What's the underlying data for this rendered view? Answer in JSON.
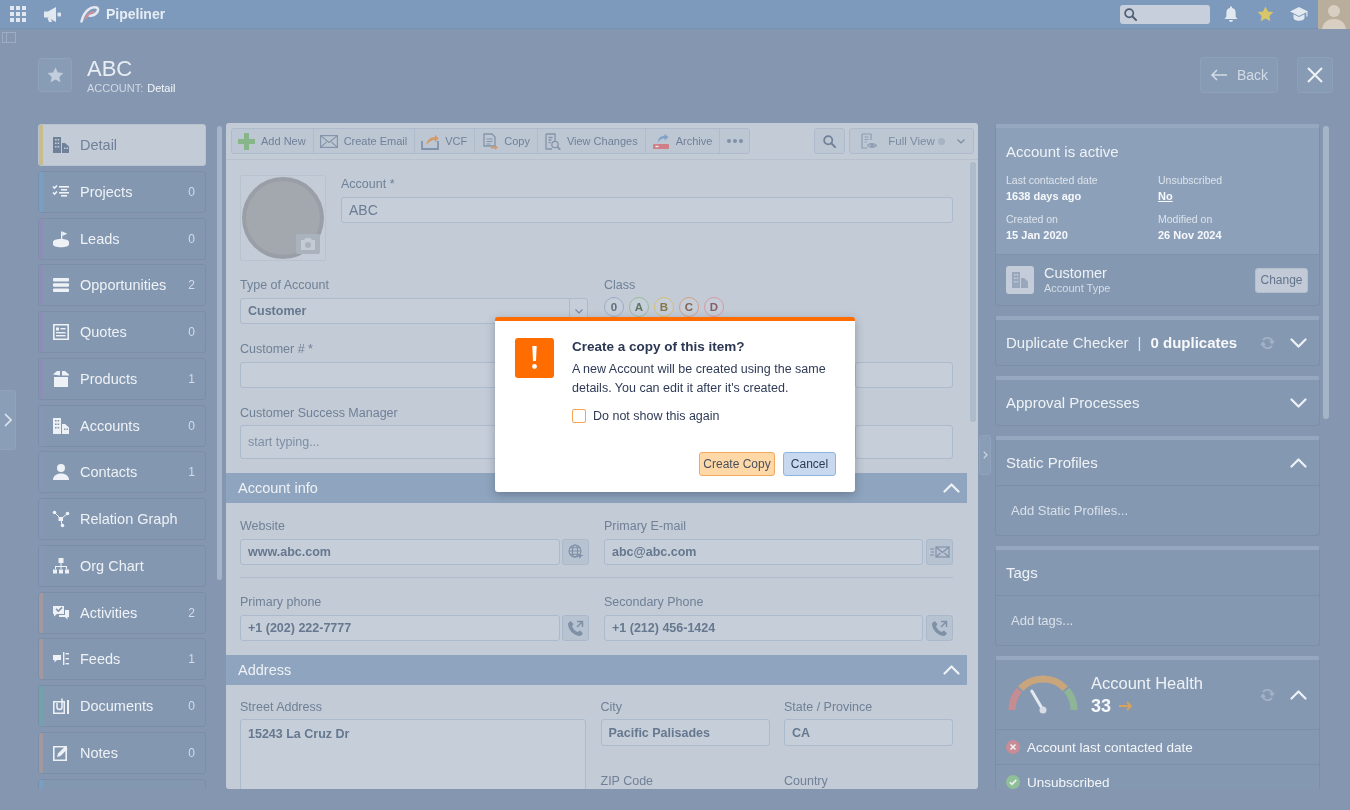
{
  "top_bar": {
    "logo": "Pipeliner"
  },
  "header": {
    "title": "ABC",
    "record_type": "ACCOUNT:",
    "view": "Detail",
    "back": "Back"
  },
  "sidebar": {
    "items": [
      {
        "label": "Detail",
        "selected": true,
        "color": "#c8bc8c"
      },
      {
        "label": "Projects",
        "count": "0",
        "selected": false,
        "color": "#7b9fc3"
      },
      {
        "label": "Leads",
        "count": "0",
        "selected": false,
        "color": "#8e8db5"
      },
      {
        "label": "Opportunities",
        "count": "2",
        "selected": false,
        "color": "#8e8db5"
      },
      {
        "label": "Quotes",
        "count": "0",
        "selected": false,
        "color": "#8e8db5"
      },
      {
        "label": "Products",
        "count": "1",
        "selected": false,
        "color": "#8e8db5"
      },
      {
        "label": "Accounts",
        "count": "0",
        "selected": false,
        "color": "#8796b6"
      },
      {
        "label": "Contacts",
        "count": "1",
        "selected": false,
        "color": "#8796b6"
      },
      {
        "label": "Relation Graph",
        "selected": false,
        "color": "#8796b6"
      },
      {
        "label": "Org Chart",
        "selected": false,
        "color": "#8796b6"
      },
      {
        "label": "Activities",
        "count": "2",
        "selected": false,
        "color": "#a3989f"
      },
      {
        "label": "Feeds",
        "count": "1",
        "selected": false,
        "color": "#a3989f"
      },
      {
        "label": "Documents",
        "count": "0",
        "selected": false,
        "color": "#73a2ac"
      },
      {
        "label": "Notes",
        "count": "0",
        "selected": false,
        "color": "#a3989f"
      },
      {
        "selected": false,
        "color": "#7b9fc3"
      }
    ]
  },
  "toolbar": {
    "actions": [
      "Add New",
      "Create Email",
      "VCF",
      "Copy",
      "View Changes",
      "Archive"
    ],
    "view_mode": "Full View"
  },
  "details": {
    "name_field": {
      "label": "Account *",
      "value": "ABC"
    },
    "fields": [
      {
        "kind": "select",
        "label": "Type of Account",
        "value": "Customer"
      },
      {
        "kind": "rating",
        "label": "Class",
        "options": [
          {
            "label": "0",
            "color": "#9aaec8",
            "selected": false
          },
          {
            "label": "A",
            "color": "#98bd97",
            "selected": false
          },
          {
            "label": "B",
            "color": "#d6bf72",
            "selected": false
          },
          {
            "label": "C",
            "color": "#d3a185",
            "selected": false
          },
          {
            "label": "D",
            "color": "#d699a0",
            "selected": false
          }
        ]
      },
      {
        "kind": "text",
        "label": "Customer # *"
      },
      {
        "kind": "text"
      },
      {
        "kind": "lookup",
        "label": "Customer Success Manager",
        "placeholder": "start typing..."
      },
      {
        "kind": "lookup"
      }
    ]
  },
  "sections": [
    {
      "kind": "two_column",
      "title": "Account info",
      "expanded": true,
      "fields": [
        {
          "kind": "url",
          "label": "Website",
          "value": "www.abc.com"
        },
        {
          "kind": "email",
          "label": "Primary E-mail",
          "value": "abc@abc.com"
        },
        {
          "kind": "phone",
          "label": "Primary phone",
          "value": "+1 (202) 222-7777"
        },
        {
          "kind": "phone",
          "label": "Secondary Phone",
          "value": "+1 (212) 456-1424"
        }
      ]
    },
    {
      "kind": "address",
      "title": "Address",
      "expanded": true,
      "fields": [
        {
          "kind": "textarea",
          "label": "Street Address",
          "value": "15243 La Cruz Dr"
        },
        {
          "kind": "text",
          "label": "City",
          "value": "Pacific Palisades"
        },
        {
          "kind": "text",
          "label": "State / Province",
          "value": "CA"
        },
        {
          "kind": "text",
          "label": "ZIP Code"
        },
        {
          "kind": "text",
          "label": "Country"
        }
      ]
    }
  ],
  "summary": {
    "title": "Account is active",
    "facts": [
      {
        "kind": "text",
        "label": "Last contacted date",
        "value": "1638 days ago"
      },
      {
        "kind": "link",
        "label": "Unsubscribed",
        "value": "No"
      },
      {
        "kind": "text",
        "label": "Created on",
        "value": "15 Jan 2020"
      },
      {
        "kind": "text",
        "label": "Modified on",
        "value": "26 Nov 2024"
      }
    ],
    "account_type": {
      "value": "Customer",
      "label": "Account Type",
      "action": "Change"
    }
  },
  "panels": [
    {
      "kind": "duplicates",
      "title": "Duplicate Checker",
      "separator": "|",
      "summary": "0 duplicates",
      "expanded": false
    },
    {
      "kind": "plain",
      "title": "Approval Processes",
      "expanded": false
    },
    {
      "kind": "input",
      "title": "Static Profiles",
      "expanded": true,
      "placeholder": "Add Static Profiles..."
    },
    {
      "kind": "input",
      "title": "Tags",
      "placeholder": "Add tags..."
    },
    {
      "kind": "health",
      "title": "Account Health",
      "score": "33",
      "expanded": true,
      "checks": [
        {
          "label": "Account last contacted date",
          "passed": false
        },
        {
          "label": "Unsubscribed",
          "passed": true
        }
      ]
    }
  ],
  "dialog": {
    "title": "Create a copy of this item?",
    "message": "A new Account will be created using the same details. You can edit it after it's created.",
    "checkbox": {
      "label": "Do not show this again",
      "checked": false
    },
    "buttons": [
      {
        "kind": "primary",
        "label": "Create Copy"
      },
      {
        "kind": "secondary",
        "label": "Cancel"
      }
    ]
  }
}
